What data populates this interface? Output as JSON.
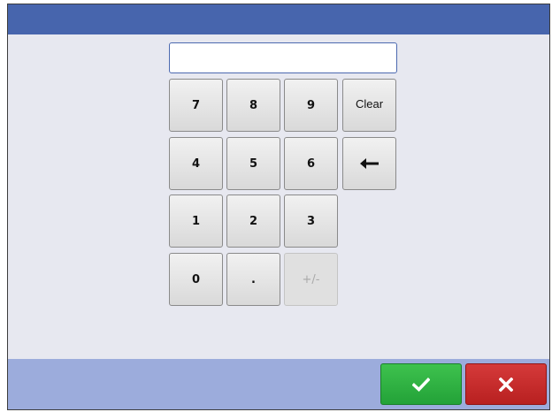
{
  "display": {
    "value": ""
  },
  "keypad": {
    "k7": "7",
    "k8": "8",
    "k9": "9",
    "clear": "Clear",
    "k4": "4",
    "k5": "5",
    "k6": "6",
    "backspace_icon": "left-arrow-icon",
    "k1": "1",
    "k2": "2",
    "k3": "3",
    "k0": "0",
    "decimal": ".",
    "sign": "+/-",
    "sign_enabled": false
  },
  "actions": {
    "confirm_icon": "checkmark-icon",
    "cancel_icon": "x-icon"
  },
  "colors": {
    "title_bar": "#4765ad",
    "background": "#e7e8f0",
    "footer": "#9cacdc",
    "confirm": "#2ab03f",
    "cancel": "#c62b2b"
  }
}
